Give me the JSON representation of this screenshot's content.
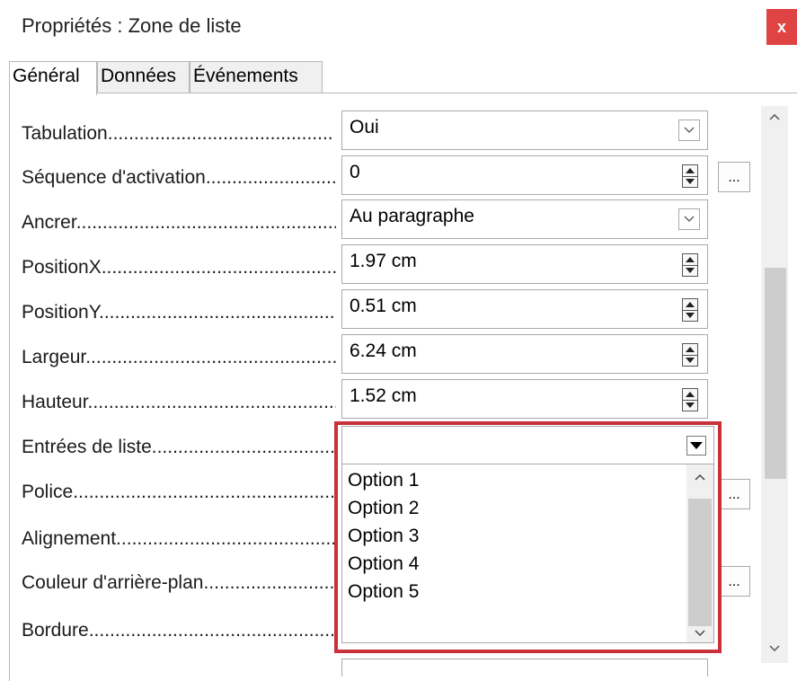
{
  "window": {
    "title": "Propriétés : Zone de liste",
    "close_label": "x"
  },
  "tabs": [
    {
      "label": "Général",
      "active": true
    },
    {
      "label": "Données",
      "active": false
    },
    {
      "label": "Événements",
      "active": false
    }
  ],
  "rows": [
    {
      "label": "Tabulation...........................................",
      "value": "Oui",
      "control": "dropdown"
    },
    {
      "label": "Séquence d'activation............................",
      "value": "0",
      "control": "spin",
      "has_dots": true
    },
    {
      "label": "Ancrer.....................................................",
      "value": "Au paragraphe",
      "control": "dropdown"
    },
    {
      "label": "PositionX................................................",
      "value": "1.97 cm",
      "control": "spin"
    },
    {
      "label": "PositionY................................................",
      "value": "0.51 cm",
      "control": "spin"
    },
    {
      "label": "Largeur...................................................",
      "value": "6.24 cm",
      "control": "spin"
    },
    {
      "label": "Hauteur...................................................",
      "value": "1.52 cm",
      "control": "spin"
    },
    {
      "label": "Entrées de liste......................................",
      "value": "",
      "control": "open-dropdown"
    },
    {
      "label": "Police.......................................................",
      "has_dots": true
    },
    {
      "label": "Alignement................................................"
    },
    {
      "label": "Couleur d'arrière-plan............................",
      "has_dots": true
    },
    {
      "label": "Bordure.....................................................",
      "value": "",
      "control": "partial"
    }
  ],
  "list_entries": [
    "Option 1",
    "Option 2",
    "Option 3",
    "Option 4",
    "Option 5"
  ],
  "dots_label": "...",
  "colors": {
    "highlight": "#c8303a",
    "close_bg": "#e04343"
  }
}
